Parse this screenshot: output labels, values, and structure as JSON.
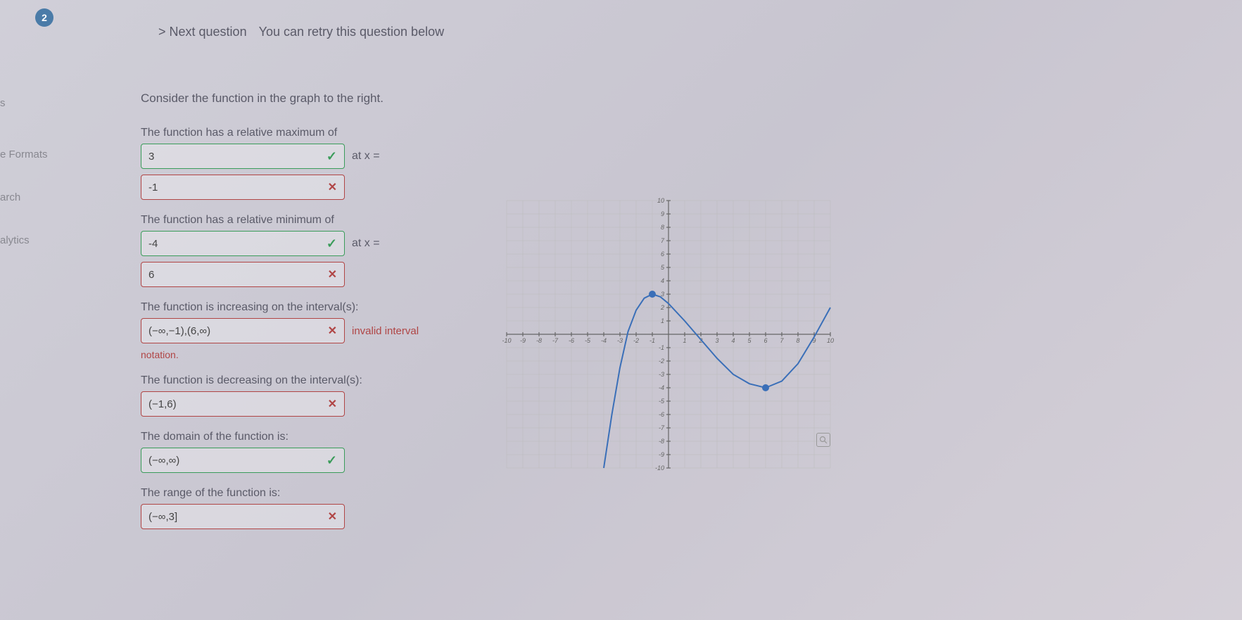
{
  "badge": "2",
  "nav": {
    "next": "> Next question",
    "retry": "You can retry this question below"
  },
  "sidebar": {
    "items": [
      "s",
      "e Formats",
      "arch",
      "alytics"
    ]
  },
  "instruction": "Consider the function in the graph to the right.",
  "questions": {
    "rel_max_label": "The function has a relative maximum of",
    "rel_max_val": "3",
    "at_x": "at x =",
    "rel_max_x": "-1",
    "rel_min_label": "The function has a relative minimum of",
    "rel_min_val": "-4",
    "rel_min_x": "6",
    "increasing_label": "The function is increasing on the interval(s):",
    "increasing_val": "(−∞,−1),(6,∞)",
    "invalid_msg": "invalid interval",
    "notation": "notation.",
    "decreasing_label": "The function is decreasing on the interval(s):",
    "decreasing_val": "(−1,6)",
    "domain_label": "The domain of the function is:",
    "domain_val": "(−∞,∞)",
    "range_label": "The range of the function is:",
    "range_val": "(−∞,3]"
  },
  "chart_data": {
    "type": "line",
    "xlim": [
      -10,
      10
    ],
    "ylim": [
      -10,
      10
    ],
    "x_ticks": [
      -10,
      -9,
      -8,
      -7,
      -6,
      -5,
      -4,
      -3,
      -2,
      -1,
      1,
      2,
      3,
      4,
      5,
      6,
      7,
      8,
      9,
      10
    ],
    "y_ticks": [
      -10,
      -9,
      -8,
      -7,
      -6,
      -5,
      -4,
      -3,
      -2,
      -1,
      1,
      2,
      3,
      4,
      5,
      6,
      7,
      8,
      9,
      10
    ],
    "marked_points": [
      {
        "x": -1,
        "y": 3,
        "type": "relative_maximum"
      },
      {
        "x": 6,
        "y": -4,
        "type": "relative_minimum"
      }
    ],
    "curve_points": [
      {
        "x": -4,
        "y": -10
      },
      {
        "x": -3.5,
        "y": -6
      },
      {
        "x": -3,
        "y": -2.5
      },
      {
        "x": -2.5,
        "y": 0.2
      },
      {
        "x": -2,
        "y": 1.8
      },
      {
        "x": -1.5,
        "y": 2.7
      },
      {
        "x": -1,
        "y": 3
      },
      {
        "x": -0.5,
        "y": 2.8
      },
      {
        "x": 0,
        "y": 2.3
      },
      {
        "x": 1,
        "y": 1
      },
      {
        "x": 2,
        "y": -0.4
      },
      {
        "x": 3,
        "y": -1.8
      },
      {
        "x": 4,
        "y": -3
      },
      {
        "x": 5,
        "y": -3.7
      },
      {
        "x": 6,
        "y": -4
      },
      {
        "x": 7,
        "y": -3.5
      },
      {
        "x": 8,
        "y": -2.2
      },
      {
        "x": 9,
        "y": -0.2
      },
      {
        "x": 10,
        "y": 2
      }
    ]
  }
}
